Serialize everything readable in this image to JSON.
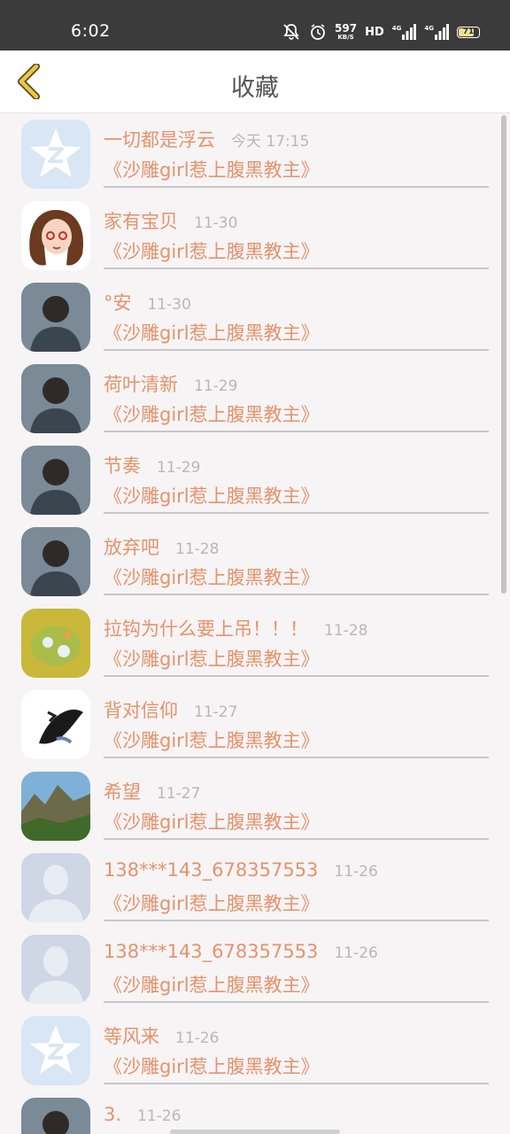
{
  "status_bar": {
    "time": "6:02",
    "net_speed_value": "597",
    "net_speed_unit": "KB/S",
    "hd_label": "HD",
    "signal1_label": "4G",
    "signal2_label": "4G",
    "battery_level": "71"
  },
  "header": {
    "title": "收藏"
  },
  "items": [
    {
      "name": "一切都是浮云",
      "time": "今天 17:15",
      "book": "《沙雕girl惹上腹黑教主》",
      "avatar": "qq-default-avatar"
    },
    {
      "name": "家有宝贝",
      "time": "11-30",
      "book": "《沙雕girl惹上腹黑教主》",
      "avatar": "cartoon-girl-avatar"
    },
    {
      "name": "°安",
      "time": "11-30",
      "book": "《沙雕girl惹上腹黑教主》",
      "avatar": "photo-avatar"
    },
    {
      "name": "荷叶清新",
      "time": "11-29",
      "book": "《沙雕girl惹上腹黑教主》",
      "avatar": "photo-avatar"
    },
    {
      "name": "节奏",
      "time": "11-29",
      "book": "《沙雕girl惹上腹黑教主》",
      "avatar": "photo-avatar"
    },
    {
      "name": "放弃吧",
      "time": "11-28",
      "book": "《沙雕girl惹上腹黑教主》",
      "avatar": "photo-avatar"
    },
    {
      "name": "拉钩为什么要上吊！！！",
      "time": "11-28",
      "book": "《沙雕girl惹上腹黑教主》",
      "avatar": "game-avatar"
    },
    {
      "name": "背对信仰",
      "time": "11-27",
      "book": "《沙雕girl惹上腹黑教主》",
      "avatar": "ink-art-avatar"
    },
    {
      "name": "希望",
      "time": "11-27",
      "book": "《沙雕girl惹上腹黑教主》",
      "avatar": "landscape-avatar"
    },
    {
      "name": "138***143_678357553",
      "time": "11-26",
      "book": "《沙雕girl惹上腹黑教主》",
      "avatar": "default-person-avatar"
    },
    {
      "name": "138***143_678357553",
      "time": "11-26",
      "book": "《沙雕girl惹上腹黑教主》",
      "avatar": "default-person-avatar"
    },
    {
      "name": "等风来",
      "time": "11-26",
      "book": "《沙雕girl惹上腹黑教主》",
      "avatar": "qq-default-avatar"
    },
    {
      "name": "3.",
      "time": "11-26",
      "book": "",
      "avatar": "photo-avatar"
    }
  ],
  "colors": {
    "accent": "#e4936b",
    "back_arrow": "#e8c74a"
  }
}
